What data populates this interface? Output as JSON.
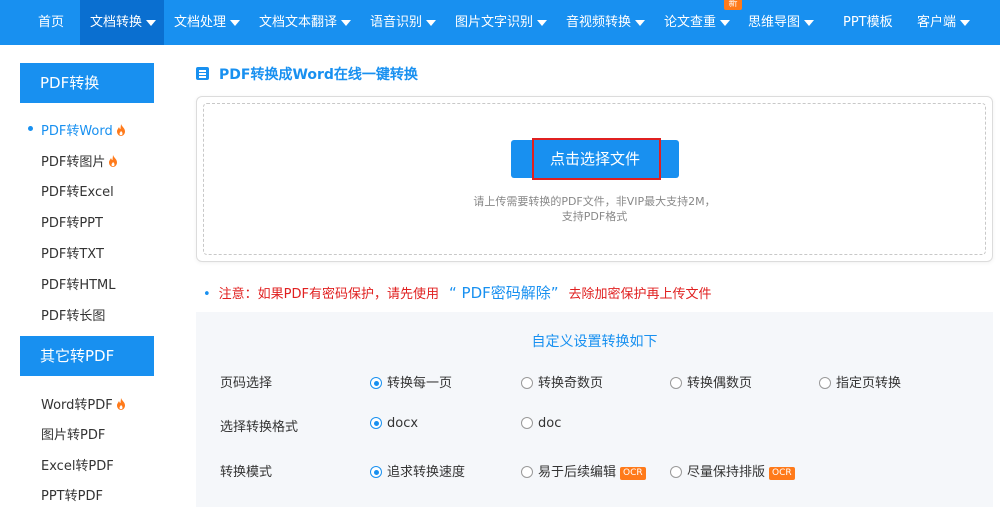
{
  "nav": {
    "items": [
      {
        "label": "首页",
        "caret": false
      },
      {
        "label": "文档转换",
        "caret": true
      },
      {
        "label": "文档处理",
        "caret": true
      },
      {
        "label": "文档文本翻译",
        "caret": true
      },
      {
        "label": "语音识别",
        "caret": true
      },
      {
        "label": "图片文字识别",
        "caret": true
      },
      {
        "label": "音视频转换",
        "caret": true
      },
      {
        "label": "论文查重",
        "caret": true
      },
      {
        "label": "思维导图",
        "caret": true
      },
      {
        "label": "PPT模板",
        "caret": false
      },
      {
        "label": "客户端",
        "caret": true
      }
    ],
    "new_badge": "新",
    "active_index": 1
  },
  "sidebar": {
    "section1": {
      "title": "PDF转换",
      "items": [
        {
          "label": "PDF转Word",
          "hot": true
        },
        {
          "label": "PDF转图片",
          "hot": true
        },
        {
          "label": "PDF转Excel",
          "hot": false
        },
        {
          "label": "PDF转PPT",
          "hot": false
        },
        {
          "label": "PDF转TXT",
          "hot": false
        },
        {
          "label": "PDF转HTML",
          "hot": false
        },
        {
          "label": "PDF转长图",
          "hot": false
        }
      ]
    },
    "section2": {
      "title": "其它转PDF",
      "items": [
        {
          "label": "Word转PDF",
          "hot": true
        },
        {
          "label": "图片转PDF",
          "hot": false
        },
        {
          "label": "Excel转PDF",
          "hot": false
        },
        {
          "label": "PPT转PDF",
          "hot": false
        }
      ]
    }
  },
  "main": {
    "title": "PDF转换成Word在线一键转换",
    "upload_button": "点击选择文件",
    "upload_hint_line1": "请上传需要转换的PDF文件，非VIP最大支持2M，",
    "upload_hint_line2": "支持PDF格式",
    "notice_prefix": "注意：如果PDF有密码保护，请先使用",
    "notice_link": "“ PDF密码解除”",
    "notice_suffix": "去除加密保护再上传文件"
  },
  "settings": {
    "title": "自定义设置转换如下",
    "rows": [
      {
        "label": "页码选择",
        "options": [
          {
            "label": "转换每一页",
            "checked": true
          },
          {
            "label": "转换奇数页",
            "checked": false
          },
          {
            "label": "转换偶数页",
            "checked": false
          },
          {
            "label": "指定页转换",
            "checked": false
          }
        ]
      },
      {
        "label": "选择转换格式",
        "options": [
          {
            "label": "docx",
            "checked": true
          },
          {
            "label": "doc",
            "checked": false
          }
        ]
      },
      {
        "label": "转换模式",
        "options": [
          {
            "label": "追求转换速度",
            "checked": true
          },
          {
            "label": "易于后续编辑",
            "checked": false,
            "badge": "OCR"
          },
          {
            "label": "尽量保持排版",
            "checked": false,
            "badge": "OCR"
          }
        ]
      }
    ]
  },
  "colors": {
    "brand": "#1890f0",
    "nav_active": "#0a6fd0",
    "warning": "#e02020",
    "hot": "#ff7a1a"
  },
  "icons": {
    "hot": "flame-icon",
    "caret": "caret-down-icon",
    "title": "document-icon"
  }
}
